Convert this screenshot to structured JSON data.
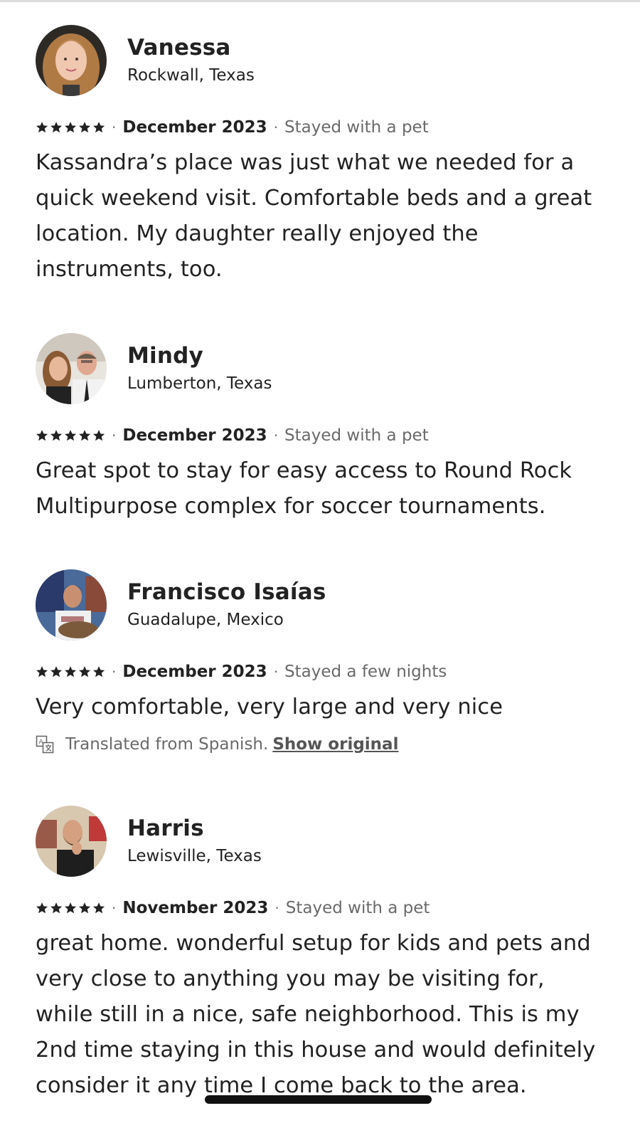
{
  "reviews": [
    {
      "name": "Vanessa",
      "location": "Rockwall, Texas",
      "rating": 5,
      "date": "December 2023",
      "stay": "Stayed with a pet",
      "text": "Kassandra’s place was just what we needed for a quick weekend visit. Comfortable beds and a great location. My daughter really enjoyed the instruments, too."
    },
    {
      "name": "Mindy",
      "location": "Lumberton, Texas",
      "rating": 5,
      "date": "December 2023",
      "stay": "Stayed with a pet",
      "text": "Great spot to stay for easy access to Round Rock Multipurpose complex for soccer tournaments."
    },
    {
      "name": "Francisco Isaías",
      "location": "Guadalupe, Mexico",
      "rating": 5,
      "date": "December 2023",
      "stay": "Stayed a few nights",
      "text": "Very comfortable, very large and very nice",
      "translation_note": "Translated from Spanish.",
      "show_original_label": "Show original"
    },
    {
      "name": "Harris",
      "location": "Lewisville, Texas",
      "rating": 5,
      "date": "November 2023",
      "stay": "Stayed with a pet",
      "text": "great home. wonderful setup for kids and pets and very close to anything you may be visiting for, while still in a nice, safe neighborhood. This is my 2nd time staying in this house and would definitely consider it any time I come back to the area."
    }
  ],
  "separator": "·",
  "icons": {
    "star": "star-icon",
    "translate": "translate-icon"
  },
  "colors": {
    "text_primary": "#222222",
    "text_secondary": "#6a6a6a"
  }
}
